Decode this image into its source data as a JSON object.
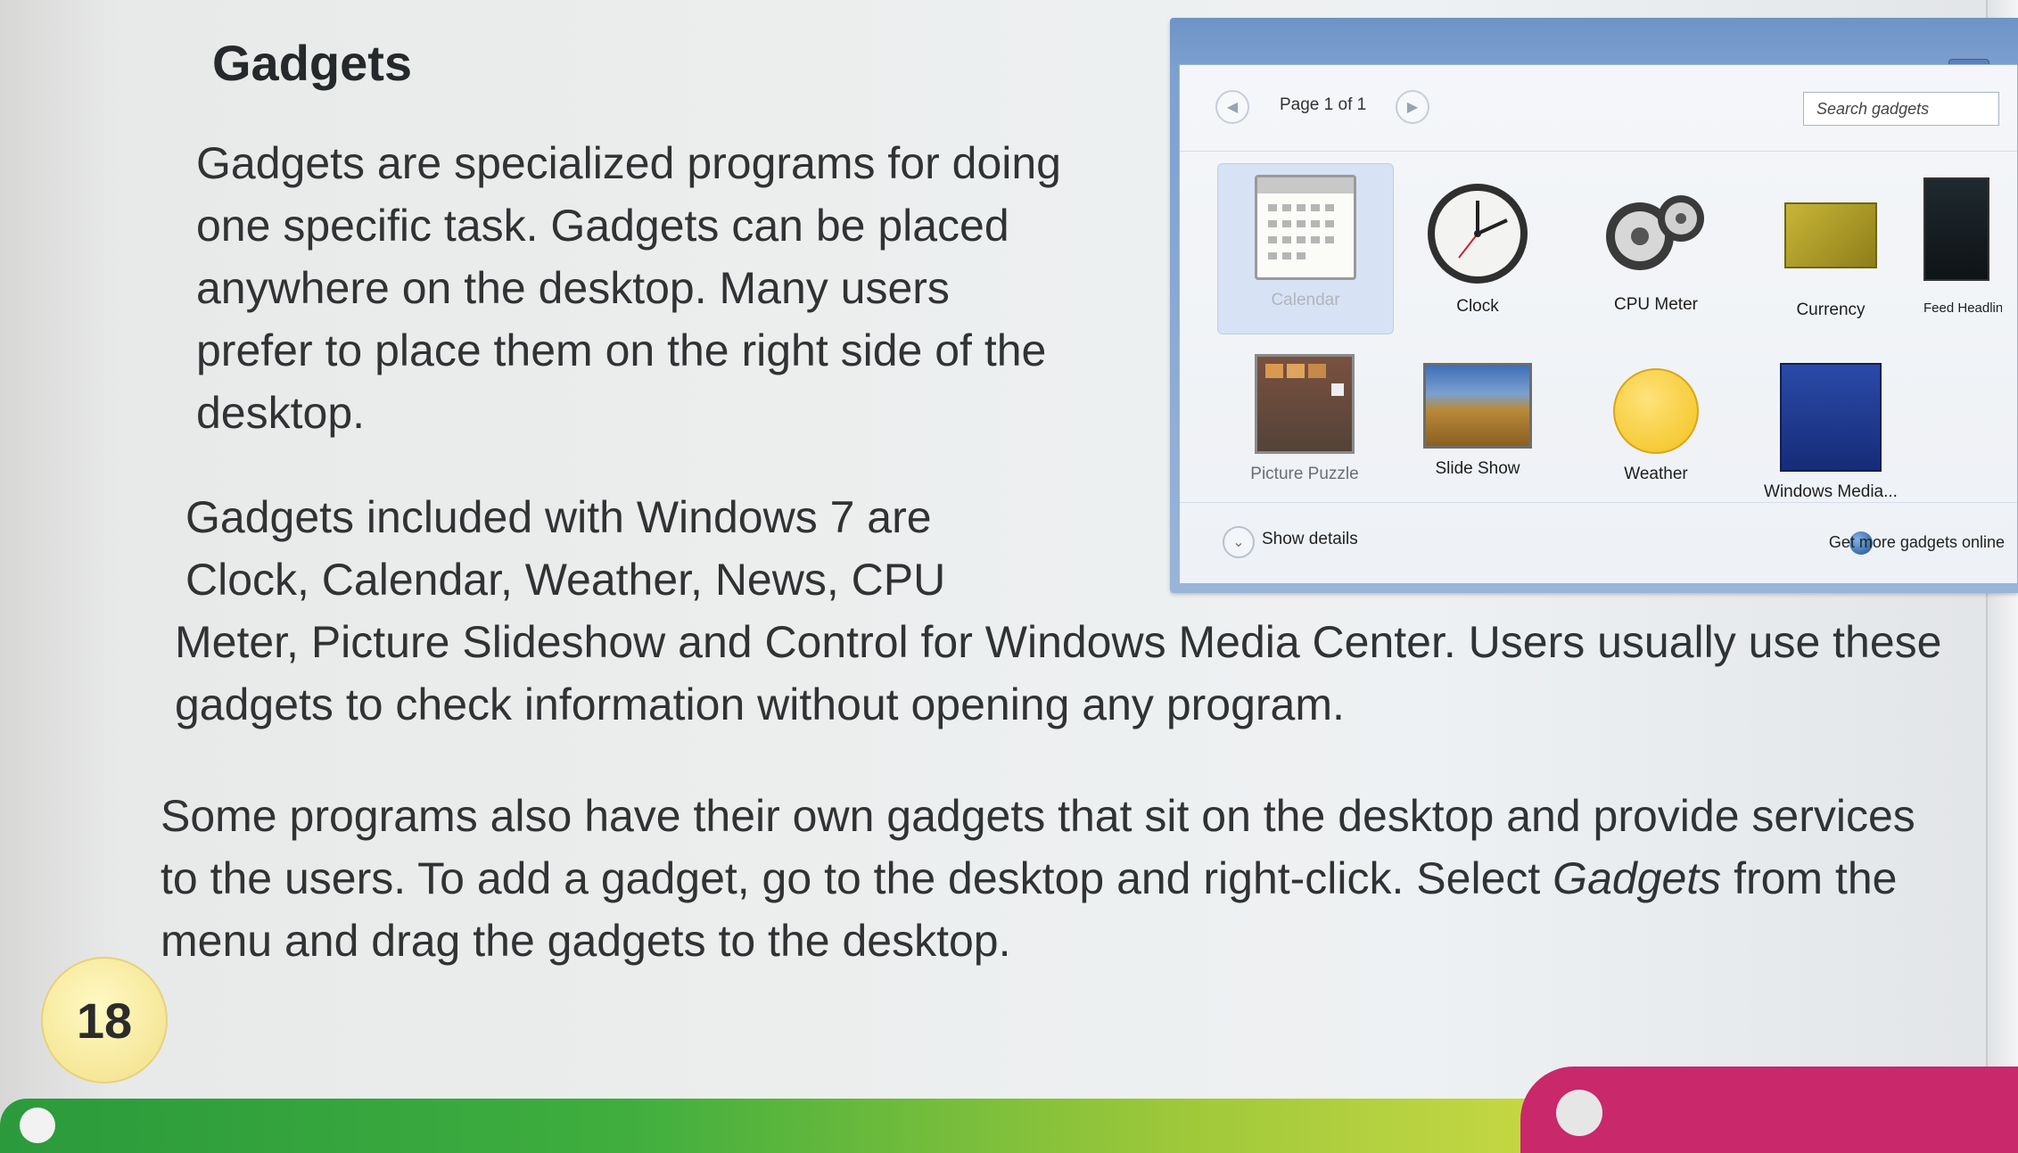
{
  "heading": "Gadgets",
  "paragraph1": [
    "Gadgets are specialized programs for doing",
    "one specific task. Gadgets can be placed",
    "anywhere on the desktop. Many users",
    "prefer to place them on the right side of the",
    "desktop."
  ],
  "paragraph2_top": [
    "Gadgets included with Windows 7 are",
    "Clock, Calendar, Weather, News, CPU"
  ],
  "paragraph2_bottom": [
    "Meter, Picture Slideshow and Control for Windows Media Center. Users usually use these",
    "gadgets to check information without opening any program."
  ],
  "paragraph3": {
    "line1": "Some programs also have their own gadgets that sit on the desktop and provide services",
    "line2_before": "to the users. To add a gadget, go to the desktop and right-click. Select ",
    "line2_italic": "Gadgets",
    "line2_after": " from the",
    "line3": "menu and drag the gadgets to the desktop."
  },
  "gadget_window": {
    "page_label": "Page 1 of 1",
    "search_placeholder": "Search gadgets",
    "show_details": "Show details",
    "get_more": "Get more gadgets online",
    "gadgets": [
      {
        "label": "Calendar",
        "icon": "calendar-icon",
        "selected": true
      },
      {
        "label": "Clock",
        "icon": "clock-icon"
      },
      {
        "label": "CPU Meter",
        "icon": "cpu-meter-icon"
      },
      {
        "label": "Currency",
        "icon": "currency-icon"
      },
      {
        "label": "Feed Headlines",
        "icon": "feed-headlines-icon"
      },
      {
        "label": "Picture Puzzle",
        "icon": "picture-puzzle-icon"
      },
      {
        "label": "Slide Show",
        "icon": "slide-show-icon"
      },
      {
        "label": "Weather",
        "icon": "weather-icon"
      },
      {
        "label": "Windows Media...",
        "icon": "windows-media-icon"
      }
    ]
  },
  "page_number": "18",
  "colors": {
    "accent_green": "#3fae3e",
    "accent_pink": "#c9286a",
    "badge_yellow": "#f2df86",
    "window_blue": "#7ea1d0"
  }
}
